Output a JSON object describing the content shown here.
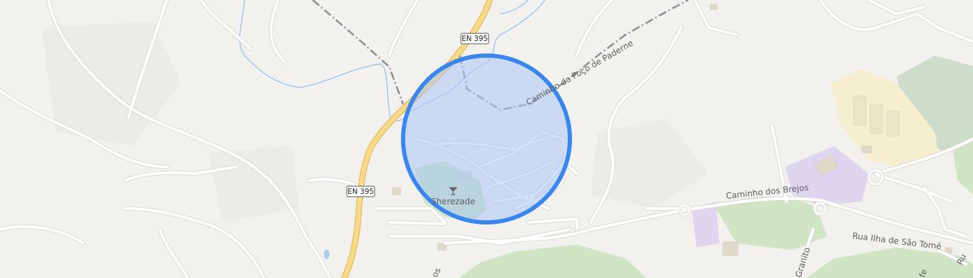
{
  "map": {
    "road_labels": {
      "en395_top": "EN 395",
      "en395_left": "EN 395",
      "caminho_poco": "Caminho do Poço de Paderne",
      "caminho_brejos": "Caminho dos Brejos",
      "rua_ilha": "Rua Ilha de São Tomé",
      "granito": "Granito",
      "bottom_os": "os",
      "right_ru": "Ru",
      "right_fe": "fe"
    },
    "poi": {
      "name": "Sherezade",
      "icon": "cocktail-bar-icon"
    },
    "radius_circle": {
      "stroke_color": "#3a86f0",
      "fill_color": "#a9c6f5"
    },
    "colors": {
      "land": "#f3f1ee",
      "road": "#ffffff",
      "road_casing": "#d9d6d1",
      "highway": "#f7d98b",
      "highway_casing": "#e3bd5c",
      "water": "#8cbcec",
      "park": "#cfe5c4",
      "industrial": "#ddd6ee",
      "commercial": "#f6efcf",
      "boundary": "#8f8f9c"
    }
  }
}
